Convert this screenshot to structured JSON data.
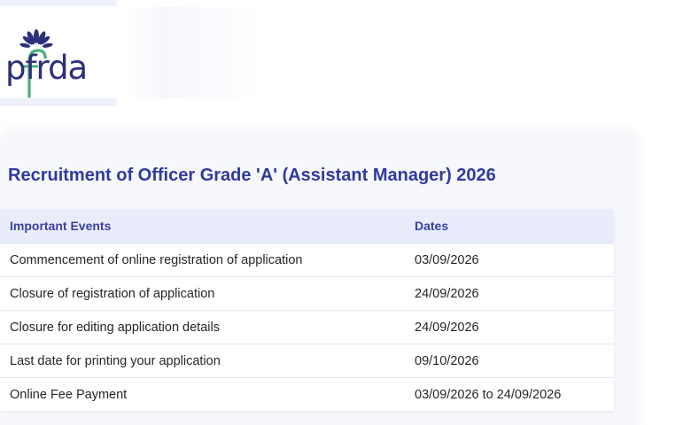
{
  "brand": {
    "logo_text": "pfrda",
    "colors": {
      "primary": "#2c2f7c",
      "accent": "#4caf7a",
      "title": "#2f3aa0"
    }
  },
  "section": {
    "title": "Recruitment of Officer Grade 'A' (Assistant Manager) 2026"
  },
  "table": {
    "headers": {
      "event": "Important Events",
      "date": "Dates"
    },
    "rows": [
      {
        "event": "Commencement of online registration of application",
        "date": "03/09/2026"
      },
      {
        "event": "Closure of registration of application",
        "date": "24/09/2026"
      },
      {
        "event": "Closure for editing application details",
        "date": "24/09/2026"
      },
      {
        "event": "Last date for printing your application",
        "date": "09/10/2026"
      },
      {
        "event": "Online Fee Payment",
        "date": "03/09/2026 to 24/09/2026"
      }
    ]
  }
}
